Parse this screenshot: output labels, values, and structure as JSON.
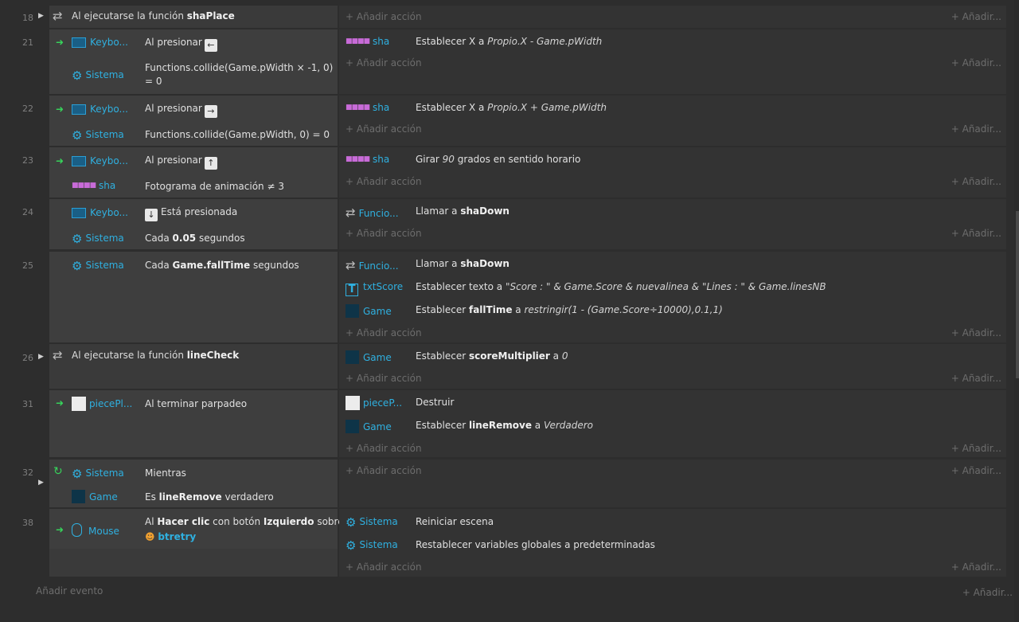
{
  "add_action_label": "Añadir acción",
  "add_right_label": "Añadir...",
  "add_event_label": "Añadir evento",
  "events": [
    {
      "number": "18",
      "title_prefix": "Al ejecutarse la función ",
      "title_bold": "shaPlace"
    },
    {
      "number": "21",
      "c1_obj": "Keybo...",
      "c1_text": "Al presionar",
      "c1_key": "←",
      "c2_obj": "Sistema",
      "c2_text": "Functions.collide(Game.pWidth × -1, 0) = 0",
      "a1_obj": "sha",
      "a1_prefix": "Establecer X a ",
      "a1_expr": "Propio.X - Game.pWidth"
    },
    {
      "number": "22",
      "c1_obj": "Keybo...",
      "c1_text": "Al presionar",
      "c1_key": "→",
      "c2_obj": "Sistema",
      "c2_text": "Functions.collide(Game.pWidth, 0) = 0",
      "a1_obj": "sha",
      "a1_prefix": "Establecer X a ",
      "a1_expr": "Propio.X + Game.pWidth"
    },
    {
      "number": "23",
      "c1_obj": "Keybo...",
      "c1_text": "Al presionar",
      "c1_key": "↑",
      "c2_obj": "sha",
      "c2_text": "Fotograma de animación ≠ 3",
      "a1_obj": "sha",
      "a1_prefix": "Girar ",
      "a1_expr": "90",
      "a1_suffix": " grados en sentido horario"
    },
    {
      "number": "24",
      "c1_obj": "Keybo...",
      "c1_key": "↓",
      "c1_text": "Está presionada",
      "c2_obj": "Sistema",
      "c2_prefix": "Cada ",
      "c2_bold": "0.05",
      "c2_suffix": " segundos",
      "a1_obj": "Funcio...",
      "a1_prefix": "Llamar a ",
      "a1_bold": "shaDown"
    },
    {
      "number": "25",
      "c1_obj": "Sistema",
      "c1_prefix": "Cada ",
      "c1_bold": "Game.fallTime",
      "c1_suffix": " segundos",
      "a1_obj": "Funcio...",
      "a1_prefix": "Llamar a ",
      "a1_bold": "shaDown",
      "a2_obj": "txtScore",
      "a2_prefix": "Establecer texto a ",
      "a2_expr": "\"Score : \" & Game.Score & nuevalinea & \"Lines : \" & Game.linesNB",
      "a3_obj": "Game",
      "a3_prefix": "Establecer ",
      "a3_bold": "fallTime",
      "a3_mid": " a ",
      "a3_expr": "restringir(1 - (Game.Score÷10000),0.1,1)"
    },
    {
      "number": "26",
      "title_prefix": "Al ejecutarse la función ",
      "title_bold": "lineCheck",
      "a1_obj": "Game",
      "a1_prefix": "Establecer ",
      "a1_bold": "scoreMultiplier",
      "a1_mid": " a ",
      "a1_expr": "0"
    },
    {
      "number": "31",
      "c1_obj": "piecePl...",
      "c1_text": "Al terminar parpadeo",
      "a1_obj": "pieceP...",
      "a1_text": "Destruir",
      "a2_obj": "Game",
      "a2_prefix": "Establecer ",
      "a2_bold": "lineRemove",
      "a2_mid": " a ",
      "a2_expr": "Verdadero"
    },
    {
      "number": "32",
      "c1_obj": "Sistema",
      "c1_text": "Mientras",
      "c2_obj": "Game",
      "c2_prefix": "Es ",
      "c2_bold": "lineRemove",
      "c2_suffix": " verdadero"
    },
    {
      "number": "38",
      "c1_obj": "Mouse",
      "c1_p1": "Al ",
      "c1_b1": "Hacer clic",
      "c1_p2": " con botón ",
      "c1_b2": "Izquierdo",
      "c1_p3": " sobre",
      "c1_b3": "btretry",
      "a1_obj": "Sistema",
      "a1_text": "Reiniciar escena",
      "a2_obj": "Sistema",
      "a2_text": "Restablecer variables globales a predeterminadas"
    }
  ]
}
